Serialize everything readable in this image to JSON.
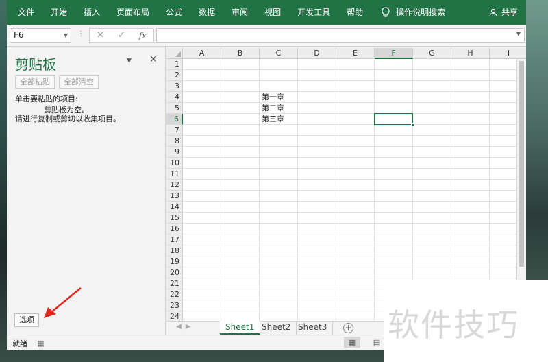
{
  "ribbon": {
    "tabs": [
      "文件",
      "开始",
      "插入",
      "页面布局",
      "公式",
      "数据",
      "审阅",
      "视图",
      "开发工具",
      "帮助"
    ],
    "tell_me": "操作说明搜索",
    "share": "共享",
    "color": "#217346"
  },
  "formula_bar": {
    "name_box": "F6",
    "fx": "fx",
    "value": ""
  },
  "clipboard": {
    "title": "剪贴板",
    "paste_all": "全部粘贴",
    "clear_all": "全部清空",
    "prompt": "单击要粘贴的项目:",
    "empty_line1": "剪贴板为空。",
    "empty_line2": "请进行复制或剪切以收集项目。",
    "options": "选项"
  },
  "grid": {
    "columns": [
      "A",
      "B",
      "C",
      "D",
      "E",
      "F",
      "G",
      "H",
      "I"
    ],
    "rows": [
      "1",
      "2",
      "3",
      "4",
      "5",
      "6",
      "7",
      "8",
      "9",
      "10",
      "11",
      "12",
      "13",
      "14",
      "15",
      "16",
      "17",
      "18",
      "19",
      "20",
      "21",
      "22",
      "23",
      "24"
    ],
    "active_column": "F",
    "active_row": "6",
    "cells": {
      "C4": "第一章",
      "C5": "第二章",
      "C6": "第三章"
    }
  },
  "sheets": [
    "Sheet1",
    "Sheet2",
    "Sheet3"
  ],
  "active_sheet": "Sheet1",
  "status": {
    "ready": "就绪"
  },
  "watermark": "软件技巧"
}
